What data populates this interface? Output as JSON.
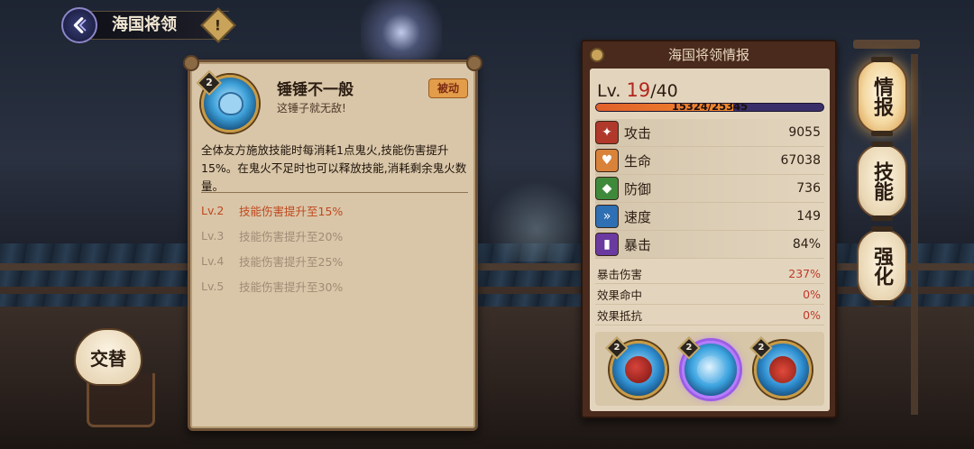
{
  "header": {
    "title": "海国将领",
    "info_glyph": "!",
    "back_icon": "chevron-left-icon"
  },
  "skill_panel": {
    "level": "2",
    "name": "锤锤不一般",
    "tagline": "这锤子就无敌!",
    "type_tag": "被动",
    "description": "全体友方施放技能时每消耗1点鬼火,技能伤害提升15%。在鬼火不足时也可以释放技能,消耗剩余鬼火数量。",
    "levels": [
      {
        "lv": "Lv.2",
        "text": "技能伤害提升至15%",
        "active": true
      },
      {
        "lv": "Lv.3",
        "text": "技能伤害提升至20%",
        "active": false
      },
      {
        "lv": "Lv.4",
        "text": "技能伤害提升至25%",
        "active": false
      },
      {
        "lv": "Lv.5",
        "text": "技能伤害提升至30%",
        "active": false
      }
    ]
  },
  "info_panel": {
    "title": "海国将领情报",
    "level_prefix": "Lv.",
    "level_current": "19",
    "level_max": "/40",
    "exp_text": "15324/25345",
    "exp_fraction": 0.6046,
    "stats": [
      {
        "label": "攻击",
        "value": "9055",
        "icon": "attack-icon",
        "color": "#b0392b"
      },
      {
        "label": "生命",
        "value": "67038",
        "icon": "health-icon",
        "color": "#d9823a"
      },
      {
        "label": "防御",
        "value": "736",
        "icon": "defense-icon",
        "color": "#3f8a3a"
      },
      {
        "label": "速度",
        "value": "149",
        "icon": "speed-icon",
        "color": "#2f6fb3"
      },
      {
        "label": "暴击",
        "value": "84%",
        "icon": "critical-icon",
        "color": "#6a3aa0"
      }
    ],
    "secondary_stats": [
      {
        "label": "暴击伤害",
        "value": "237%"
      },
      {
        "label": "效果命中",
        "value": "0%"
      },
      {
        "label": "效果抵抗",
        "value": "0%"
      }
    ],
    "skills": [
      {
        "level": "2",
        "icon": "claw-skill-icon",
        "selected": false
      },
      {
        "level": "2",
        "icon": "hammer-skill-icon",
        "selected": true
      },
      {
        "level": "2",
        "icon": "crab-skill-icon",
        "selected": false
      }
    ]
  },
  "side_tabs": [
    {
      "label": "情报",
      "active": true
    },
    {
      "label": "技能",
      "active": false
    },
    {
      "label": "强化",
      "active": false
    }
  ],
  "swap_button": "交替"
}
